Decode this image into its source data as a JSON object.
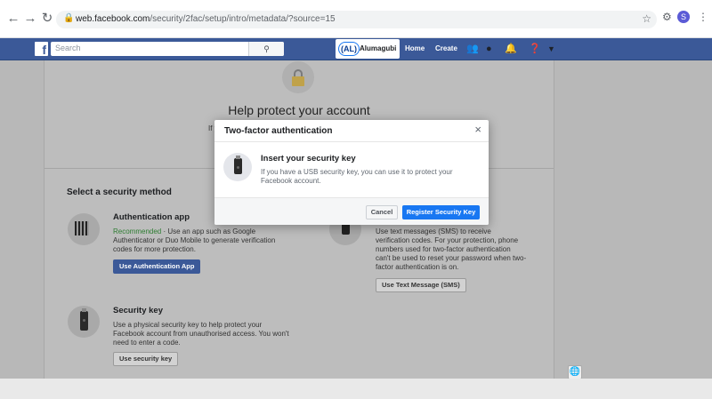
{
  "browser": {
    "url_host": "web.facebook.com",
    "url_path": "/security/2fac/setup/intro/metadata/?source=15",
    "profile_initial": "S",
    "icons": [
      "back-arrow-icon",
      "forward-arrow-icon",
      "reload-icon",
      "lock-icon",
      "star-icon",
      "extensions-icon",
      "menu-icon"
    ]
  },
  "fb_bar": {
    "logo": "f",
    "search_placeholder": "Search",
    "profile_logo": "(AL)",
    "profile_name": "Alumagubi",
    "home_label": "Home",
    "create_label": "Create",
    "color": "#3b5998"
  },
  "page": {
    "title": "Help protect your account",
    "intro_fragment": "If y",
    "select_title": "Select a security method",
    "methods": [
      {
        "title": "Authentication app",
        "recommended": "Recommended",
        "desc_line1": " · Use an app such as Google",
        "desc_line2": "Authenticator or Duo Mobile to generate verification",
        "desc_line3": "codes for more protection.",
        "button": "Use Authentication App"
      },
      {
        "desc_line1": "Use text messages (SMS) to receive",
        "desc_line2": "verification codes. For your protection, phone",
        "desc_line3": "numbers used for two-factor authentication",
        "desc_line4": "can't be used to reset your password when two-",
        "desc_line5": "factor authentication is on.",
        "button": "Use Text Message (SMS)"
      },
      {
        "title": "Security key",
        "desc_line1": "Use a physical security key to help protect your",
        "desc_line2": "Facebook account from unauthorised access. You won't",
        "desc_line3": "need to enter a code.",
        "button": "Use security key"
      }
    ]
  },
  "modal": {
    "title": "Two-factor authentication",
    "close": "×",
    "subtitle": "Insert your security key",
    "desc_line1": "If you have a USB security key, you can use it to protect your",
    "desc_line2": "Facebook account.",
    "cancel": "Cancel",
    "register": "Register Security Key",
    "accent": "#1877f2"
  }
}
